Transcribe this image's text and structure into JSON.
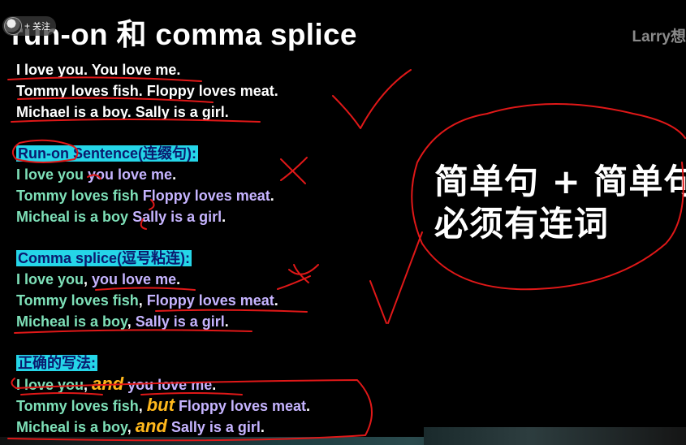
{
  "title": "run-on 和 comma splice",
  "watermark": "Larry想",
  "follow_pill": {
    "plus": "+",
    "label": "关注"
  },
  "correct_block": [
    "I love you. You love me.",
    "Tommy loves fish. Floppy loves meat.",
    "Michael is a boy. Sally is a girl."
  ],
  "runon": {
    "header_a": "Run-on",
    "header_b": " Sentence(连缀句):",
    "lines": [
      {
        "a": "I love you",
        "b": " you love me",
        "end": "."
      },
      {
        "a": "Tommy loves fish",
        "b": " Floppy loves meat",
        "end": "."
      },
      {
        "a": "Micheal is a boy",
        "b": " Sally is a girl",
        "end": "."
      }
    ]
  },
  "splice": {
    "header": "Comma splice(逗号粘连):",
    "lines": [
      {
        "a": "I love you",
        "sep": ", ",
        "b": "you love me",
        "end": "."
      },
      {
        "a": "Tommy loves fish",
        "sep": ", ",
        "b": "Floppy loves meat",
        "end": "."
      },
      {
        "a": "Micheal is a boy",
        "sep": ", ",
        "b": "Sally is a girl",
        "end": "."
      }
    ]
  },
  "proper": {
    "header": "正确的写法:",
    "lines": [
      {
        "a": "I love you",
        "sep": ", ",
        "conj": "and",
        "b": " you love me",
        "end": "."
      },
      {
        "a": "Tommy loves fish",
        "sep": ", ",
        "conj": "but",
        "b": " Floppy loves meat",
        "end": "."
      },
      {
        "a": "Micheal is a boy",
        "sep": ", ",
        "conj": "and",
        "b": " Sally is a girl",
        "end": "."
      }
    ]
  },
  "note": {
    "line1": "简单句 + 简单句",
    "line2": "必须有连词"
  },
  "colors": {
    "highlight": "#25d6e8",
    "conjunction": "#ffb81c",
    "ink": "#e01818",
    "green_text": "#7ee0b8",
    "purple_text": "#c6b4ff"
  }
}
